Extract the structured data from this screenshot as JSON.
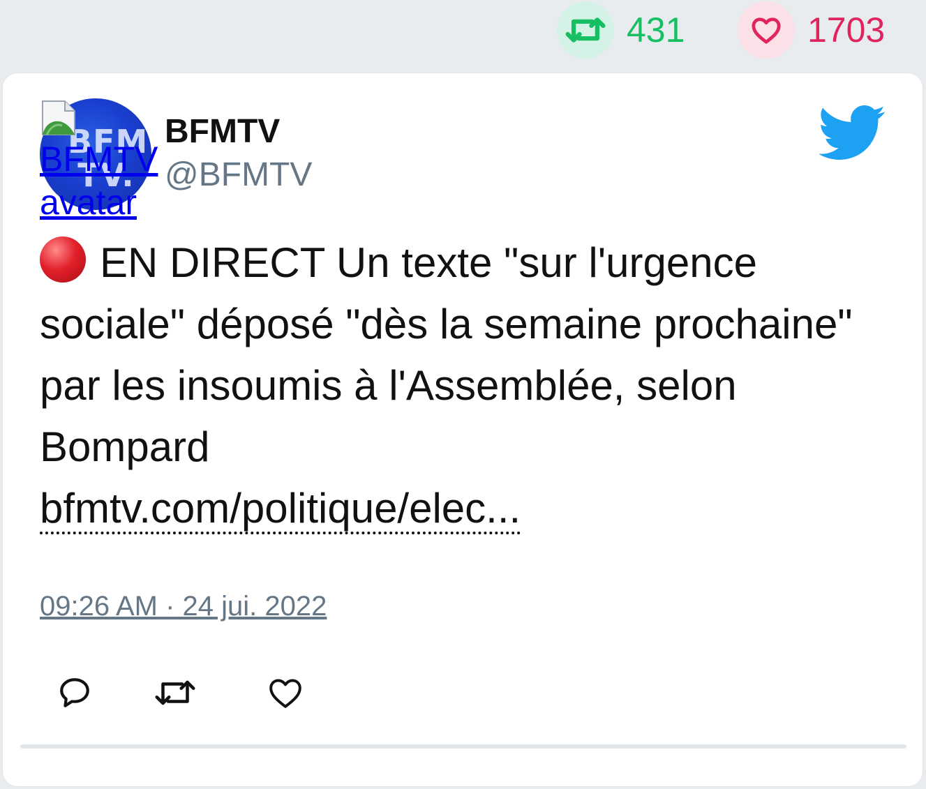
{
  "stats": {
    "retweets": "431",
    "likes": "1703"
  },
  "author": {
    "name": "BFMTV",
    "handle": "@BFMTV",
    "avatar_alt": "BFMTV\navatar",
    "avatar_logo": "BFM\nTV."
  },
  "tweet": {
    "text": "EN DIRECT Un texte \"sur l'urgence sociale\" déposé \"dès la semaine prochaine\" par les insoumis à l'Assemblée, selon Bompard",
    "link": "bfmtv.com/politique/elec...",
    "timestamp": "09:26 AM · 24 jui. 2022"
  },
  "icons": {
    "retweet_stat": "retweet-icon",
    "like_stat": "heart-icon",
    "brand": "twitter-bird-icon",
    "reply": "reply-icon",
    "retweet": "retweet-icon",
    "like": "heart-icon",
    "live": "red-circle-emoji"
  },
  "colors": {
    "retweet": "#17bf63",
    "like": "#e0245e",
    "twitter": "#1da1f2",
    "muted": "#657786"
  }
}
